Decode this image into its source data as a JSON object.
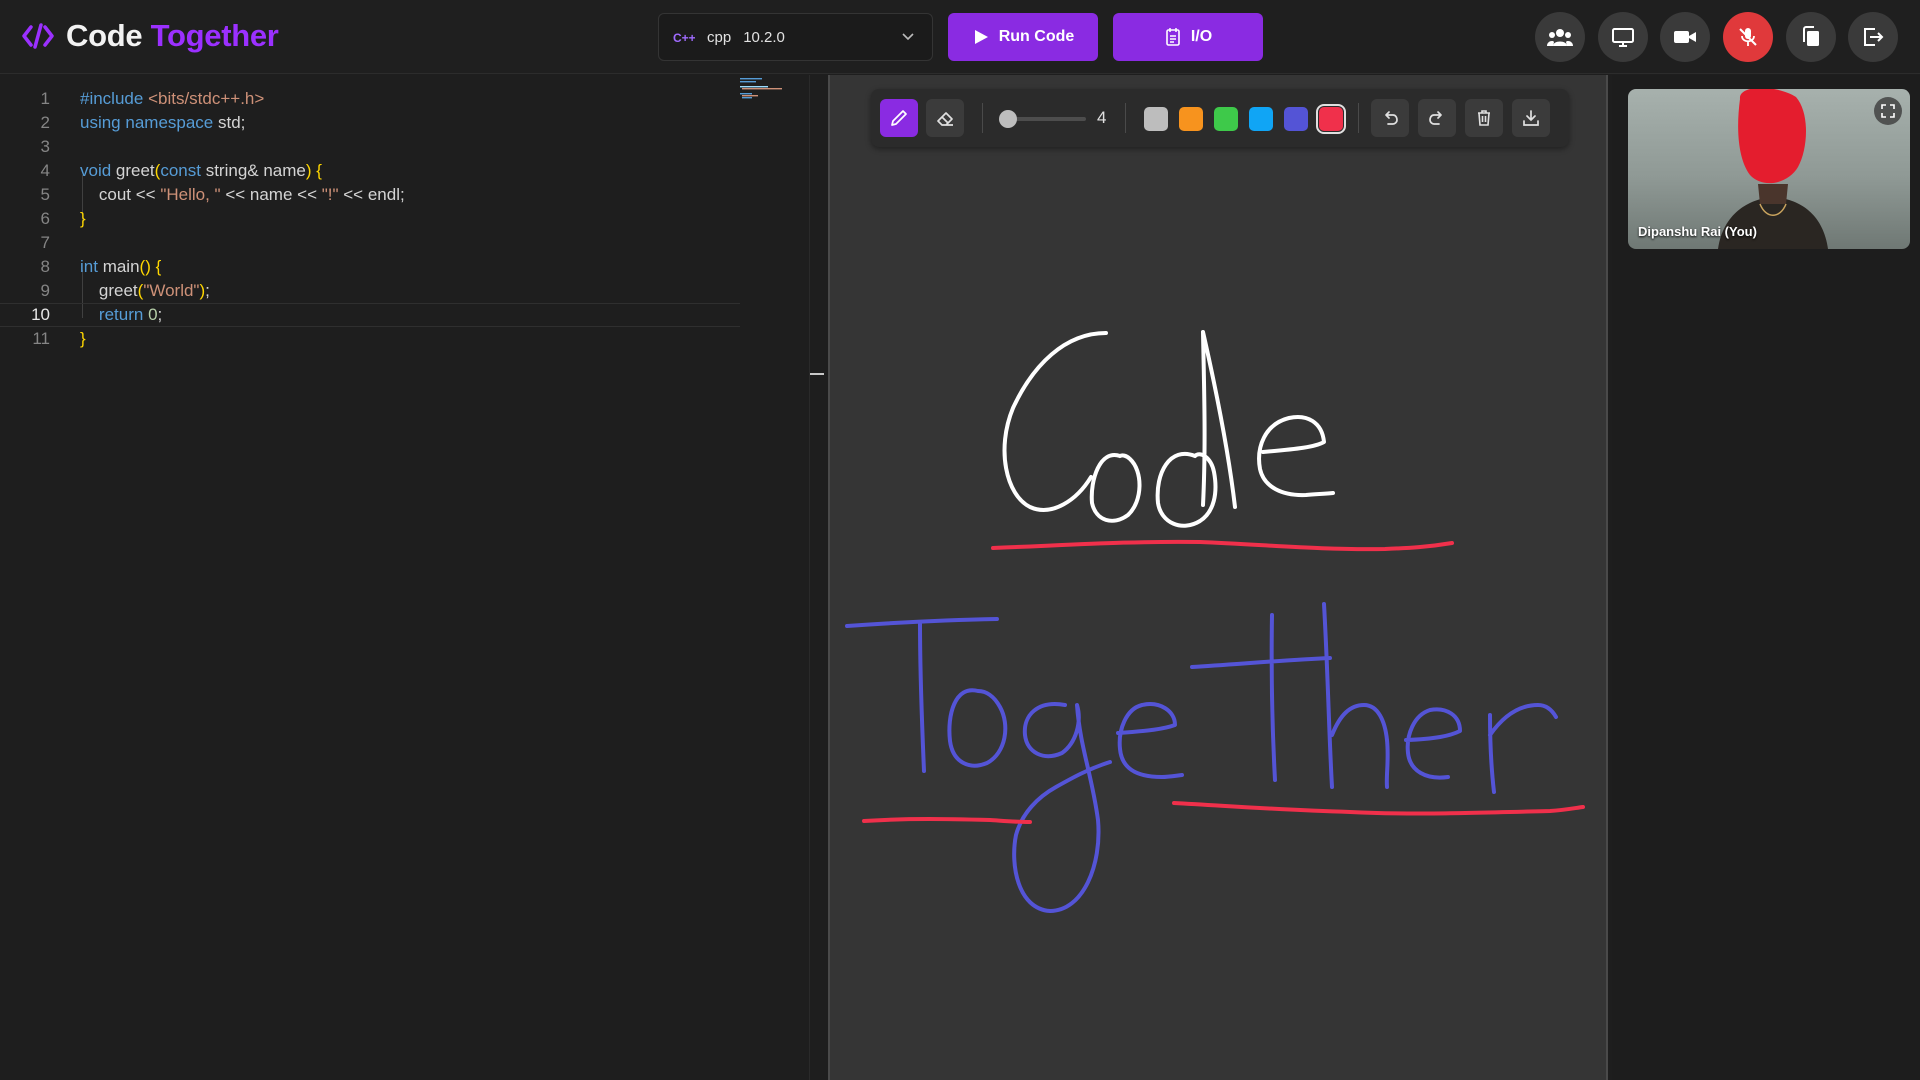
{
  "brand": {
    "word1": "Code",
    "word2": "Together",
    "icon": "code-brackets-icon"
  },
  "language": {
    "name": "cpp",
    "version": "10.2.0",
    "icon": "cpp-icon"
  },
  "actions": {
    "run_label": "Run Code",
    "io_label": "I/O"
  },
  "header_icons": [
    "participants-icon",
    "screen-share-icon",
    "camera-icon",
    "mic-off-icon",
    "copy-icon",
    "leave-icon"
  ],
  "editor": {
    "active_line": 10,
    "lines": [
      {
        "n": "1",
        "text": "#include <bits/stdc++.h>"
      },
      {
        "n": "2",
        "text": "using namespace std;"
      },
      {
        "n": "3",
        "text": ""
      },
      {
        "n": "4",
        "text": "void greet(const string& name) {"
      },
      {
        "n": "5",
        "text": "    cout << \"Hello, \" << name << \"!\" << endl;"
      },
      {
        "n": "6",
        "text": "}"
      },
      {
        "n": "7",
        "text": ""
      },
      {
        "n": "8",
        "text": "int main() {"
      },
      {
        "n": "9",
        "text": "    greet(\"World\");"
      },
      {
        "n": "10",
        "text": "    return 0;"
      },
      {
        "n": "11",
        "text": "}"
      }
    ]
  },
  "whiteboard": {
    "brush_size": "4",
    "colors": [
      "#bdbdbd",
      "#f7931e",
      "#3ec94a",
      "#10a5f5",
      "#5454d6",
      "#f0304b"
    ],
    "selected_color": "#f0304b",
    "tools": [
      "pen-icon",
      "eraser-icon",
      "undo-icon",
      "redo-icon",
      "trash-icon",
      "download-icon"
    ]
  },
  "video": {
    "name": "Dipanshu Rai (You)"
  },
  "colors": {
    "accent": "#8a2be2",
    "danger": "#e0393b"
  }
}
